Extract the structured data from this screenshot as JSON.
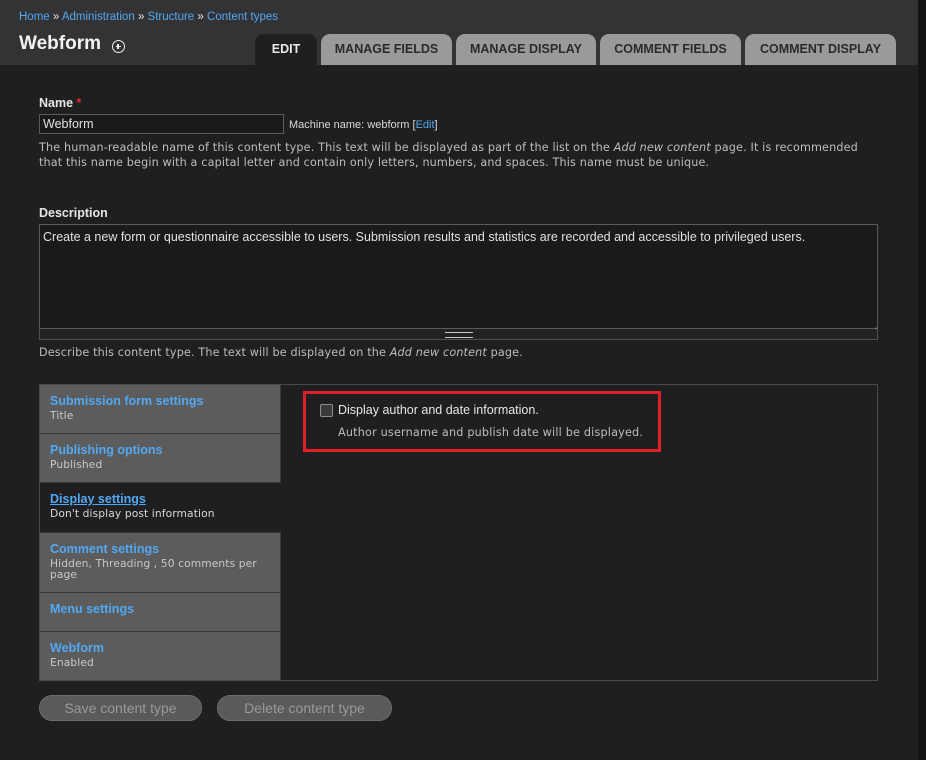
{
  "breadcrumb": {
    "items": [
      "Home",
      "Administration",
      "Structure",
      "Content types"
    ],
    "separator": "»"
  },
  "page_title": "Webform",
  "tabs": [
    {
      "label": "EDIT",
      "active": true
    },
    {
      "label": "MANAGE FIELDS",
      "active": false
    },
    {
      "label": "MANAGE DISPLAY",
      "active": false
    },
    {
      "label": "COMMENT FIELDS",
      "active": false
    },
    {
      "label": "COMMENT DISPLAY",
      "active": false
    }
  ],
  "name_field": {
    "label": "Name",
    "required_marker": "*",
    "value": "Webform",
    "machine_name_prefix": "Machine name: webform [",
    "machine_name_edit": "Edit",
    "machine_name_suffix": "]",
    "help_part1": "The human-readable name of this content type. This text will be displayed as part of the list on the ",
    "help_emph": "Add new content",
    "help_part2": " page. It is recommended that this name begin with a capital letter and contain only letters, numbers, and spaces. This name must be unique."
  },
  "description_field": {
    "label": "Description",
    "value": "Create a new form or questionnaire accessible to users. Submission results and statistics are recorded and accessible to privileged users.",
    "help_part1": "Describe this content type. The text will be displayed on the ",
    "help_emph": "Add new content",
    "help_part2": " page."
  },
  "vertical_tabs": [
    {
      "title": "Submission form settings",
      "summary": "Title",
      "selected": false
    },
    {
      "title": "Publishing options",
      "summary": "Published",
      "selected": false
    },
    {
      "title": "Display settings",
      "summary": "Don't display post information",
      "selected": true
    },
    {
      "title": "Comment settings",
      "summary": "Hidden, Threading , 50 comments per page",
      "selected": false
    },
    {
      "title": "Menu settings",
      "summary": "",
      "selected": false
    },
    {
      "title": "Webform",
      "summary": "Enabled",
      "selected": false
    }
  ],
  "display_settings": {
    "checkbox_label": "Display author and date information.",
    "checkbox_checked": false,
    "checkbox_description": "Author username and publish date will be displayed."
  },
  "actions": {
    "save_label": "Save content type",
    "delete_label": "Delete content type"
  },
  "colors": {
    "link": "#52a8f2",
    "highlight_border": "#e41e26",
    "required": "#e02b2b"
  }
}
